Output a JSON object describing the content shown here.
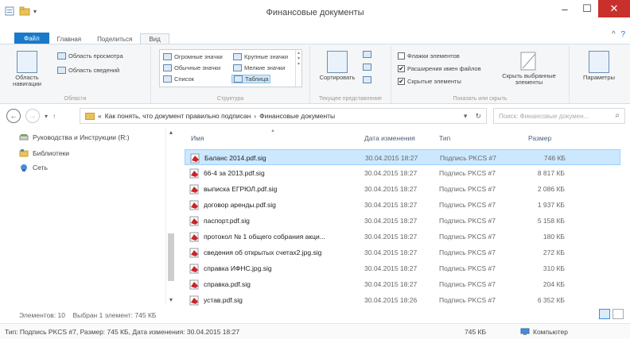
{
  "window": {
    "title": "Финансовые документы",
    "buttons": {
      "minimize": "–",
      "maximize": "☐",
      "close": "✕"
    }
  },
  "ribbon_tabs": [
    {
      "label": "Файл",
      "kind": "file"
    },
    {
      "label": "Главная",
      "kind": "normal"
    },
    {
      "label": "Поделиться",
      "kind": "normal"
    },
    {
      "label": "Вид",
      "kind": "active"
    }
  ],
  "ribbon_help": "?",
  "ribbon": {
    "panes": {
      "nav_pane_label": "Область навигации",
      "preview_label": "Область просмотра",
      "details_label": "Область сведений",
      "group_label": "Области"
    },
    "layout": {
      "items": [
        "Огромные значки",
        "Крупные значки",
        "Обычные значки",
        "Мелкие значки",
        "Список",
        "Таблица"
      ],
      "group_label": "Структура"
    },
    "current_view": {
      "sort_label": "Сортировать",
      "group_label": "Текущее представление"
    },
    "show_hide": {
      "items": [
        {
          "label": "Флажки элементов",
          "checked": false
        },
        {
          "label": "Расширения имен файлов",
          "checked": true
        },
        {
          "label": "Скрытые элементы",
          "checked": true
        }
      ],
      "hide_selected_label": "Скрыть выбранные элементы",
      "group_label": "Показать или скрыть"
    },
    "options": {
      "label": "Параметры"
    }
  },
  "address": {
    "path": [
      "Как понять, что документ правильно подписан",
      "Финансовые документы"
    ],
    "search_placeholder": "Поиск: Финансовые докумен..."
  },
  "nav_pane": {
    "items": [
      {
        "label": "Руководства и Инструкции (R:)",
        "icon": "drive-icon"
      },
      {
        "label": "Библиотеки",
        "icon": "library-icon"
      },
      {
        "label": "Сеть",
        "icon": "network-icon"
      }
    ]
  },
  "columns": [
    "Имя",
    "Дата изменения",
    "Тип",
    "Размер"
  ],
  "files": [
    {
      "name": "Баланс 2014.pdf.sig",
      "date": "30.04.2015 18:27",
      "type": "Подпись PKCS #7",
      "size": "746 КБ",
      "selected": true
    },
    {
      "name": "66-4 за 2013.pdf.sig",
      "date": "30.04.2015 18:27",
      "type": "Подпись PKCS #7",
      "size": "8 817 КБ",
      "selected": false
    },
    {
      "name": "выписка ЕГРЮЛ.pdf.sig",
      "date": "30.04.2015 18:27",
      "type": "Подпись PKCS #7",
      "size": "2 086 КБ",
      "selected": false
    },
    {
      "name": "договор аренды.pdf.sig",
      "date": "30.04.2015 18:27",
      "type": "Подпись PKCS #7",
      "size": "1 937 КБ",
      "selected": false
    },
    {
      "name": "паспорт.pdf.sig",
      "date": "30.04.2015 18:27",
      "type": "Подпись PKCS #7",
      "size": "5 158 КБ",
      "selected": false
    },
    {
      "name": "протокол № 1 общего собрания акци...",
      "date": "30.04.2015 18:27",
      "type": "Подпись PKCS #7",
      "size": "180 КБ",
      "selected": false
    },
    {
      "name": "сведения об открытых счетах2.jpg.sig",
      "date": "30.04.2015 18:27",
      "type": "Подпись PKCS #7",
      "size": "272 КБ",
      "selected": false
    },
    {
      "name": "справка ИФНС.jpg.sig",
      "date": "30.04.2015 18:27",
      "type": "Подпись PKCS #7",
      "size": "310 КБ",
      "selected": false
    },
    {
      "name": "справка.pdf.sig",
      "date": "30.04.2015 18:27",
      "type": "Подпись PKCS #7",
      "size": "204 КБ",
      "selected": false
    },
    {
      "name": "устав.pdf.sig",
      "date": "30.04.2015 18:26",
      "type": "Подпись PKCS #7",
      "size": "6 352 КБ",
      "selected": false
    }
  ],
  "status": {
    "count": "Элементов: 10",
    "selected": "Выбран 1 элемент: 745 КБ",
    "details": "Тип: Подпись PKCS #7, Размер: 745 КБ, Дата изменения: 30.04.2015 18:27",
    "size": "745 КБ",
    "location": "Компьютер"
  },
  "colors": {
    "file_tab": "#1979ca",
    "close_button": "#c9302c",
    "selection": "#cce8ff",
    "pdf_icon": "#c8262a"
  }
}
